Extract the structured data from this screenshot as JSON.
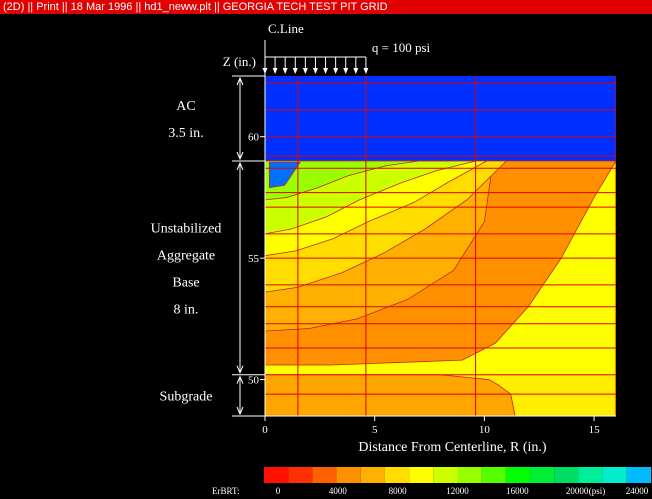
{
  "title_bar": {
    "text": "(2D) || Print || 18 Mar 1996 || hd1_neww.plt || GEORGIA TECH TEST PIT GRID",
    "color": "#e00000"
  },
  "chart_data": {
    "type": "heatmap",
    "title": "",
    "xlabel": "Distance From Centerline, R (in.)",
    "ylabel": "Z (in.)",
    "xlim": [
      0,
      16
    ],
    "ylim": [
      48.5,
      62.5
    ],
    "x_ticks": [
      "0",
      "5",
      "10",
      "15"
    ],
    "y_ticks": [
      "50",
      "55",
      "60"
    ],
    "centerline_label": "C.Line",
    "load_label": "q = 100 psi",
    "load_extent_x": [
      0,
      4.6
    ],
    "layers": [
      {
        "name": "AC",
        "thickness": "3.5 in.",
        "z_top": 62.5,
        "z_bottom": 59.0,
        "color": "#0030ff"
      },
      {
        "name": "Unstabilized Aggregate Base",
        "thickness": "8 in.",
        "z_top": 59.0,
        "z_bottom": 50.2
      },
      {
        "name": "Subgrade",
        "thickness": "",
        "z_top": 50.2,
        "z_bottom": 48.5
      }
    ],
    "layer_label_lines": [
      [
        "AC",
        "3.5 in."
      ],
      [
        "Unstabilized",
        "Aggregate",
        "Base",
        "8 in."
      ],
      [
        "Subgrade"
      ]
    ],
    "grid_x": [
      0,
      1.5,
      4.6,
      9.6,
      16
    ],
    "grid_z": [
      62.2,
      61.1,
      60.0,
      59.2,
      58.7,
      57.7,
      57.1,
      56.0,
      55.0,
      53.9,
      53.0,
      52.3,
      51.3,
      50.2,
      49.4,
      48.5
    ],
    "base_zones": [
      {
        "label_index": 8,
        "boundary_x": [
          0.0,
          1.0,
          2.4,
          3.8,
          5.5,
          7.0,
          8.6
        ],
        "boundary_z": [
          57.4,
          57.5,
          57.9,
          58.4,
          58.8,
          59.0,
          59.0
        ]
      },
      {
        "label_index": 7,
        "boundary_x": [
          0.0,
          1.2,
          2.8,
          4.3,
          6.2,
          7.8,
          9.6
        ],
        "boundary_z": [
          56.0,
          56.2,
          56.7,
          57.4,
          58.1,
          58.6,
          59.0
        ]
      },
      {
        "label_index": 6,
        "boundary_x": [
          0.0,
          1.4,
          3.1,
          4.7,
          6.8,
          8.3,
          10.1
        ],
        "boundary_z": [
          55.1,
          55.3,
          55.8,
          56.5,
          57.3,
          58.1,
          59.0
        ]
      },
      {
        "label_index": 5,
        "boundary_x": [
          0.0,
          1.5,
          3.5,
          5.4,
          7.3,
          9.2,
          11.0
        ],
        "boundary_z": [
          53.6,
          53.8,
          54.4,
          55.2,
          56.2,
          57.4,
          59.0
        ]
      },
      {
        "label_index": 4,
        "boundary_x": [
          0.0,
          2.0,
          4.2,
          6.5,
          8.6,
          10.0,
          10.4
        ],
        "boundary_z": [
          52.0,
          52.1,
          52.5,
          53.3,
          54.5,
          56.5,
          59.0
        ]
      },
      {
        "label_index": 3,
        "boundary_x": [
          0.0,
          3.0,
          6.0,
          9.0,
          10.5,
          12.0,
          13.5,
          15.0,
          16.0
        ],
        "boundary_z": [
          50.6,
          50.6,
          50.7,
          50.8,
          51.5,
          53.0,
          55.0,
          57.5,
          59.0
        ]
      }
    ],
    "subgrade_zones": [
      {
        "label_index": 2,
        "boundary_x": [
          0.0,
          8.0,
          10.2,
          10.6,
          11.2,
          11.4
        ],
        "boundary_z": [
          50.2,
          50.2,
          50.0,
          49.8,
          49.4,
          48.5
        ]
      },
      {
        "label_index": 3,
        "boundary_x": [
          11.4,
          16.0
        ],
        "boundary_z": [
          48.5,
          48.5
        ]
      }
    ],
    "colorbar": {
      "label": "ErBRT:",
      "unit": "(psi)",
      "tick_labels": [
        "0",
        "4000",
        "8000",
        "12000",
        "16000",
        "20000",
        "24000"
      ],
      "colors": [
        "#ff1000",
        "#ff3000",
        "#ff6000",
        "#ff9000",
        "#ffb000",
        "#ffdd00",
        "#ffff00",
        "#ccff00",
        "#99ff00",
        "#55ff00",
        "#00ff00",
        "#00ee33",
        "#00dd66",
        "#00ee99",
        "#00eecc",
        "#00bbff"
      ]
    },
    "grid": true,
    "grid_color": "#e00000"
  }
}
